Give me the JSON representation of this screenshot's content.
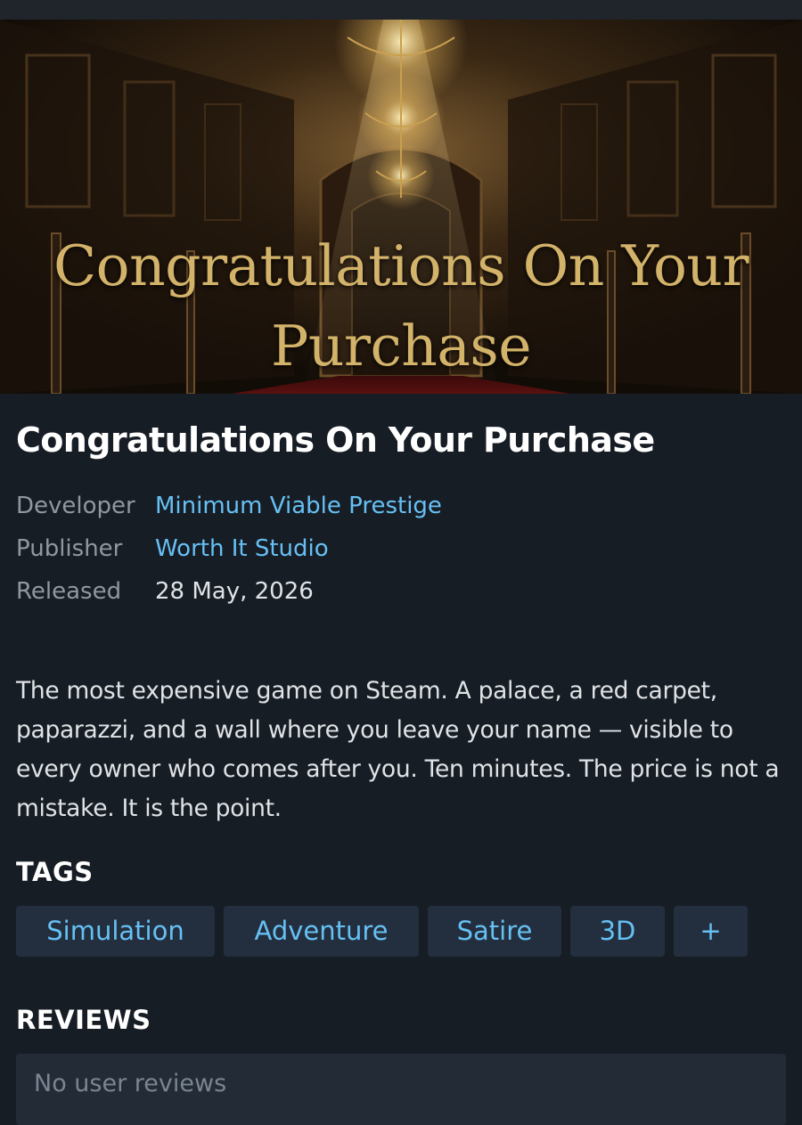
{
  "hero": {
    "banner_title_line1": "Congratulations On Your",
    "banner_title_line2": "Purchase"
  },
  "game": {
    "title": "Congratulations On Your Purchase",
    "developer_label": "Developer",
    "developer": "Minimum Viable Prestige",
    "publisher_label": "Publisher",
    "publisher": "Worth It Studio",
    "released_label": "Released",
    "released": "28 May, 2026",
    "description": "The most expensive game on Steam. A palace, a red carpet, paparazzi, and a wall where you leave your name — visible to every owner who comes after you. Ten minutes. The price is not a mistake. It is the point."
  },
  "tags": {
    "heading": "TAGS",
    "items": [
      "Simulation",
      "Adventure",
      "Satire",
      "3D",
      "+"
    ]
  },
  "reviews": {
    "heading": "REVIEWS",
    "empty_text": "No user reviews"
  },
  "colors": {
    "background": "#171d25",
    "link": "#66c0f4",
    "label": "#8f98a0",
    "tag_background": "#232f3e",
    "banner_gold": "#d3b36a"
  }
}
